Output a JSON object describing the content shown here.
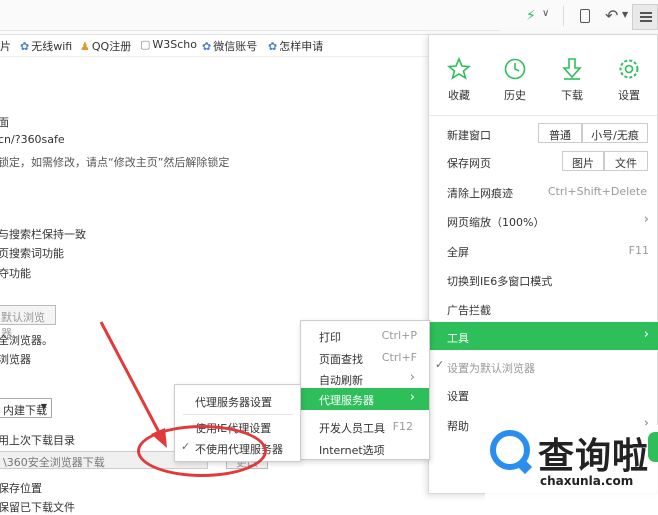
{
  "toolbar": {
    "menu_icon": "hamburger-icon",
    "icons": [
      "bolt-icon",
      "chevron-down-icon",
      "phone-icon",
      "undo-icon",
      "chevron-down-icon"
    ]
  },
  "favorites": [
    {
      "label": "片"
    },
    {
      "label": "无线wifi"
    },
    {
      "label": "QQ注册"
    },
    {
      "label": "W3Scho"
    },
    {
      "label": "微信账号"
    },
    {
      "label": "怎样申请"
    }
  ],
  "page": {
    "line1": "面",
    "line2": "cn/?360safe",
    "line3": "锁定，如需修改，请点“修改主页”然后解除锁定",
    "line4": "与搜索栏保持一致",
    "line5": "页搜索词功能",
    "line6": "夺功能",
    "default_btn": "默认浏览器",
    "line7": "全浏览器。",
    "line8": "浏览器",
    "download_select": "内建下载",
    "line9": "用上次下载目录",
    "download_path": "\\360安全浏览器下载",
    "browse_btn": "更改",
    "line10": "保存位置",
    "line11": "保留已下载文件"
  },
  "menu": {
    "top": [
      {
        "label": "收藏",
        "icon": "star-icon"
      },
      {
        "label": "历史",
        "icon": "clock-icon"
      },
      {
        "label": "下载",
        "icon": "download-icon"
      },
      {
        "label": "设置",
        "icon": "gear-icon"
      }
    ],
    "new_window": {
      "label": "新建窗口",
      "opt1": "普通",
      "opt2": "小号/无痕"
    },
    "save_page": {
      "label": "保存网页",
      "opt1": "图片",
      "opt2": "文件"
    },
    "clear_traces": {
      "label": "清除上网痕迹",
      "shortcut": "Ctrl+Shift+Delete"
    },
    "zoom": {
      "label": "网页缩放（100%）"
    },
    "fullscreen": {
      "label": "全屏",
      "shortcut": "F11"
    },
    "ie6_mode": {
      "label": "切换到IE6多窗口模式"
    },
    "ad_block": {
      "label": "广告拦截"
    },
    "tools": {
      "label": "工具"
    },
    "set_default": {
      "label": "设置为默认浏览器"
    },
    "settings": {
      "label": "设置"
    },
    "help": {
      "label": "帮助"
    }
  },
  "tools_menu": [
    {
      "label": "打印",
      "shortcut": "Ctrl+P"
    },
    {
      "label": "页面查找",
      "shortcut": "Ctrl+F"
    },
    {
      "label": "自动刷新",
      "shortcut": ""
    },
    {
      "label": "代理服务器",
      "shortcut": ""
    },
    {
      "label": "开发人员工具",
      "shortcut": "F12"
    },
    {
      "label": "Internet选项",
      "shortcut": ""
    }
  ],
  "proxy_menu": [
    {
      "label": "代理服务器设置"
    },
    {
      "label": "使用IE代理设置"
    },
    {
      "label": "不使用代理服务器"
    }
  ],
  "watermark": {
    "text": "查询啦",
    "url": "chaxunla.com"
  },
  "colors": {
    "accent": "#2ebf5b",
    "annotation": "#e23a3a",
    "watermark_blue": "#2a8ef0"
  }
}
